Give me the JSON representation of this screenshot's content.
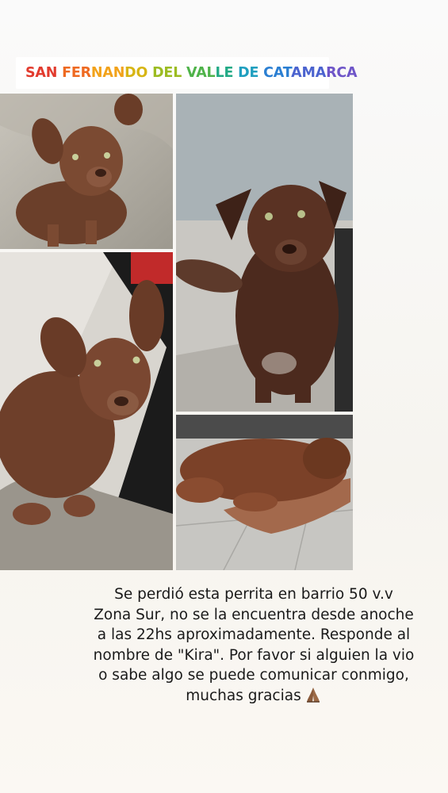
{
  "location": {
    "icon": "location-pin-icon",
    "text": "SAN FERNANDO DEL VALLE DE CATAMARCA",
    "rainbow_colors": [
      "#e23b2e",
      "#ee6a22",
      "#f2a21a",
      "#d7b514",
      "#9cbc22",
      "#4fb34a",
      "#22aa86",
      "#1f9fbf",
      "#2b7fd2",
      "#4b63cf",
      "#6e55c8"
    ]
  },
  "photos": [
    {
      "name": "dog-photo-1",
      "subject": "brown puppy sitting on concrete"
    },
    {
      "name": "dog-photo-2",
      "subject": "brown puppy lying near a chair"
    },
    {
      "name": "dog-photo-3",
      "subject": "brown dog sitting indoors"
    },
    {
      "name": "dog-photo-4",
      "subject": "brown dog sleeping on a towel"
    }
  ],
  "caption": {
    "lines": [
      "Se perdió esta perrita en barrio 50 v.v",
      "Zona Sur, no se la encuentra desde anoche",
      "a las 22hs aproximadamente. Responde al",
      "nombre de \"Kira\". Por favor si alguien la vio",
      "o sabe algo se puede comunicar conmigo,",
      "muchas gracias"
    ],
    "emoji": "praying-hands-icon"
  }
}
